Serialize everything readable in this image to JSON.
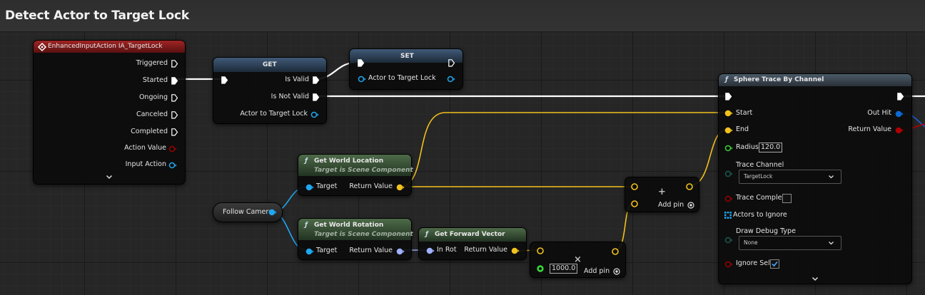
{
  "comment": {
    "title": "Detect Actor to Target Lock"
  },
  "event_node": {
    "title": "EnhancedInputAction IA_TargetLock",
    "pins": [
      "Triggered",
      "Started",
      "Ongoing",
      "Canceled",
      "Completed",
      "Action Value",
      "Input Action"
    ]
  },
  "get_node": {
    "title": "GET",
    "is_valid": "Is Valid",
    "is_not_valid": "Is Not Valid",
    "input": "Actor to Target Lock"
  },
  "set_node": {
    "title": "SET",
    "input": "Actor to Target Lock"
  },
  "follow_camera": {
    "label": "Follow Camera"
  },
  "get_world_location": {
    "title": "Get World Location",
    "subtitle": "Target is Scene Component",
    "target": "Target",
    "return": "Return Value"
  },
  "get_world_rotation": {
    "title": "Get World Rotation",
    "subtitle": "Target is Scene Component",
    "target": "Target",
    "return": "Return Value"
  },
  "get_forward_vector": {
    "title": "Get Forward Vector",
    "in": "In Rot",
    "return": "Return Value"
  },
  "add_node_1": {
    "add_pin": "Add pin"
  },
  "add_node_2": {
    "value": "1000.0",
    "add_pin": "Add pin"
  },
  "sphere_trace": {
    "title": "Sphere Trace By Channel",
    "start": "Start",
    "end": "End",
    "radius": "Radius",
    "radius_value": "120.0",
    "trace_channel": "Trace Channel",
    "trace_channel_value": "TargetLock",
    "trace_complex": "Trace Complex",
    "actors_to_ignore": "Actors to Ignore",
    "draw_debug_type": "Draw Debug Type",
    "draw_debug_value": "None",
    "ignore_self": "Ignore Self",
    "out_hit": "Out Hit",
    "return": "Return Value"
  },
  "colors": {
    "exec": "#ffffff",
    "vector": "#f2c21c",
    "object": "#1fa8f2",
    "rotator": "#9fb1ff",
    "float": "#37d437",
    "bool": "#9b0000",
    "struct": "#0b6bd6"
  }
}
